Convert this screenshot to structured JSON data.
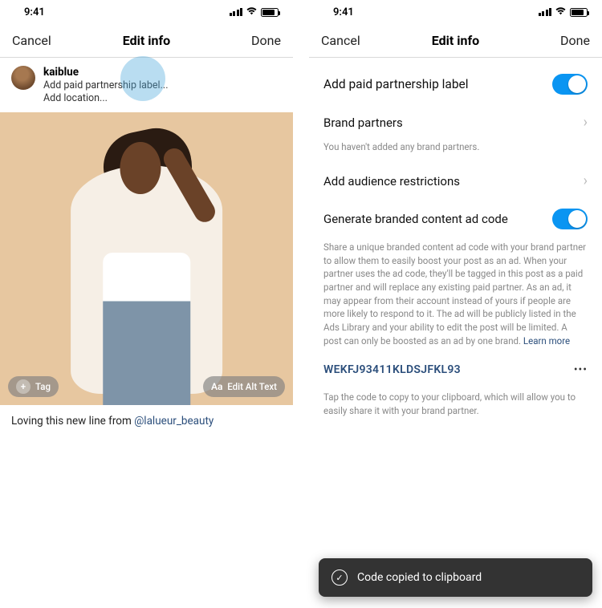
{
  "statusbar": {
    "time": "9:41"
  },
  "nav": {
    "cancel": "Cancel",
    "title": "Edit info",
    "done": "Done"
  },
  "left": {
    "username": "kaiblue",
    "paid_label_prompt": "Add paid partnership label...",
    "location_prompt": "Add location...",
    "tag_button": "Tag",
    "alt_button": "Edit Alt Text",
    "aa_icon": "Aa",
    "caption_text": "Loving this new line from ",
    "caption_mention": "@lalueur_beauty"
  },
  "right": {
    "paid_label_row": "Add paid partnership label",
    "brand_partners_row": "Brand partners",
    "brand_partners_help": "You haven't added any brand partners.",
    "audience_row": "Add audience restrictions",
    "generate_row": "Generate branded content ad code",
    "ad_desc": "Share a unique branded content ad code with your brand partner to allow them to easily boost your post as an ad. When your partner uses the ad code, they'll be tagged in this post as a paid partner and will replace any existing paid partner. As an ad, it may appear from their account instead of yours if people are more likely to respond to it. The ad will be publicly listed in the Ads Library and your ability to edit the post will be limited. A post can only be boosted as an ad by one brand. ",
    "learn_more": "Learn more",
    "ad_code": "WEKFJ93411KLDSJFKL93",
    "code_help": "Tap the code to copy to your clipboard, which will allow you to easily share it with your brand partner.",
    "toast_text": "Code copied to clipboard"
  }
}
